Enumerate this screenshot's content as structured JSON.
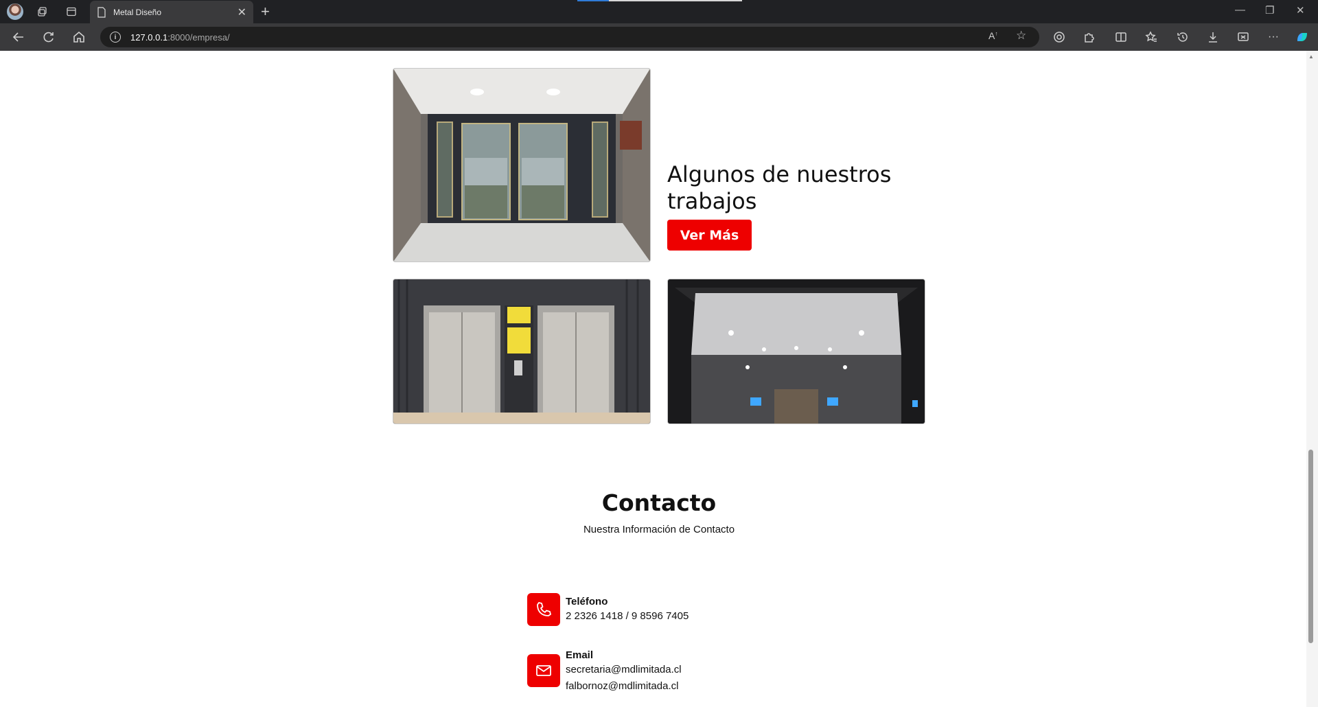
{
  "browser": {
    "tab_title": "Metal Diseño",
    "url_host": "127.0.0.1",
    "url_rest": ":8000/empresa/"
  },
  "works": {
    "heading": "Algunos de nuestros trabajos",
    "button_label": "Ver Más"
  },
  "contact": {
    "title": "Contacto",
    "subtitle": "Nuestra Información de Contacto",
    "phone": {
      "label": "Teléfono",
      "value": "2 2326 1418 / 9 8596 7405",
      "icon": "phone-icon"
    },
    "email": {
      "label": "Email",
      "values": [
        "secretaria@mdlimitada.cl",
        "falbornoz@mdlimitada.cl"
      ],
      "icon": "mail-icon"
    }
  },
  "colors": {
    "accent": "#ee0000",
    "chrome_dark": "#202124"
  }
}
